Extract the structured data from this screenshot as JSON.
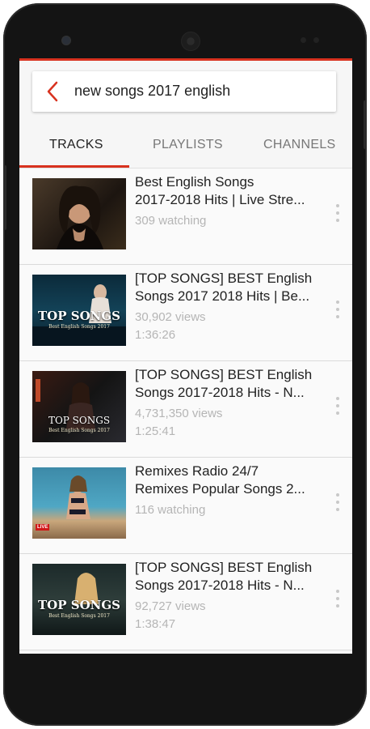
{
  "search": {
    "query": "new songs 2017 english"
  },
  "tabs": [
    {
      "label": "TRACKS",
      "active": true
    },
    {
      "label": "PLAYLISTS",
      "active": false
    },
    {
      "label": "CHANNELS",
      "active": false
    }
  ],
  "results": [
    {
      "title1": "Best English Songs",
      "title2": "2017-2018 Hits | Live Stre...",
      "meta1": "309 watching",
      "meta2": ""
    },
    {
      "title1": "[TOP SONGS] BEST English",
      "title2": "Songs 2017 2018 Hits | Be...",
      "meta1": "30,902 views",
      "meta2": "1:36:26",
      "thumb_text": "TOP SONGS",
      "thumb_sub": "Best English Songs 2017"
    },
    {
      "title1": "[TOP SONGS] BEST English",
      "title2": "Songs 2017-2018 Hits - N...",
      "meta1": "4,731,350 views",
      "meta2": "1:25:41",
      "thumb_text": "TOP SONGS",
      "thumb_sub": "Best English Songs 2017"
    },
    {
      "title1": "Remixes Radio 24/7",
      "title2": "Remixes Popular Songs 2...",
      "meta1": "116 watching",
      "meta2": "",
      "thumb_badge": "LIVE"
    },
    {
      "title1": "[TOP SONGS] BEST English",
      "title2": "Songs 2017-2018 Hits - N...",
      "meta1": "92,727 views",
      "meta2": "1:38:47",
      "thumb_text": "TOP SONGS",
      "thumb_sub": "Best English Songs 2017"
    }
  ],
  "colors": {
    "accent": "#d8321f",
    "text": "#222222",
    "meta": "#b5b5b5"
  }
}
